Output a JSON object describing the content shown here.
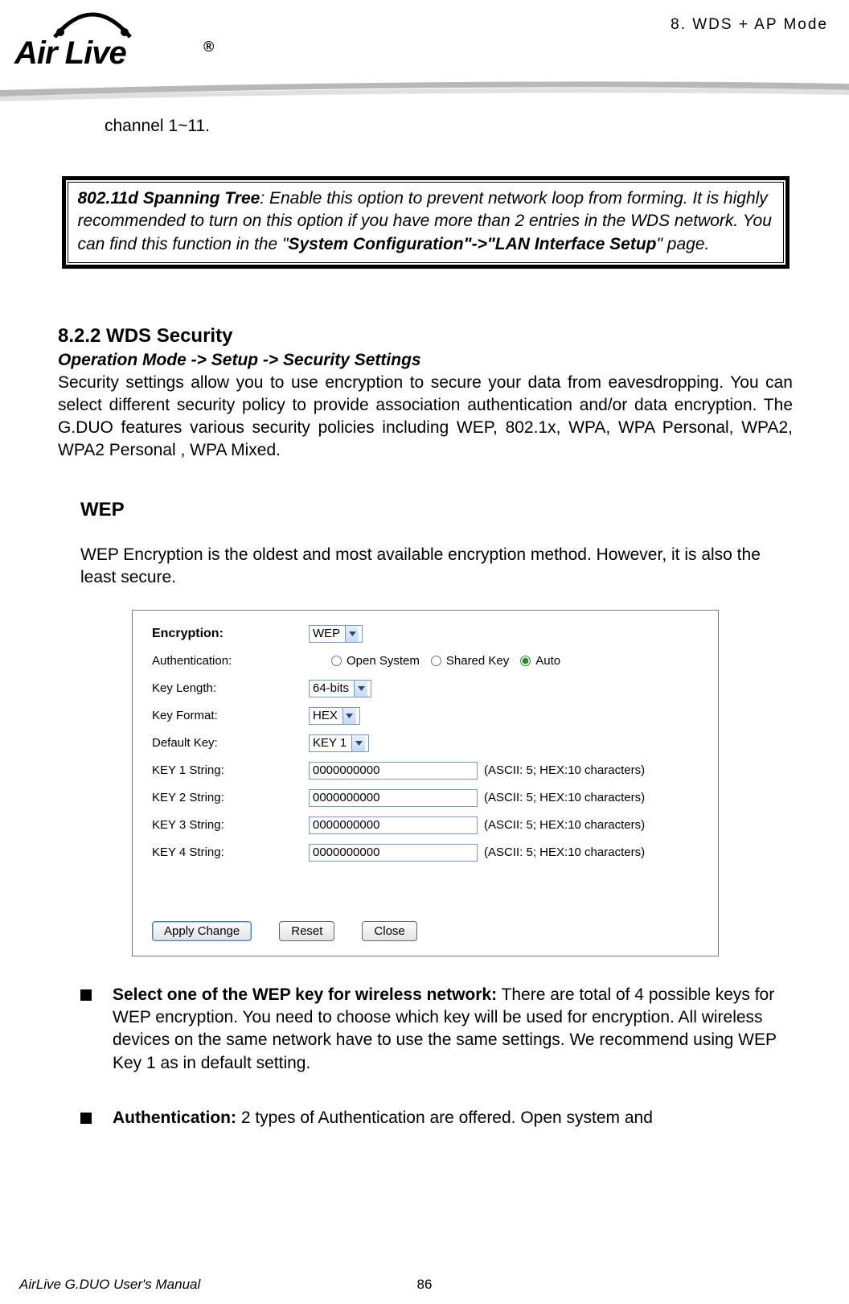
{
  "header": {
    "section_label": "8.  WDS  +  AP  Mode",
    "logo_text": "Air Live"
  },
  "intro_text": "channel 1~11.",
  "note": {
    "prefix": "802.11d Spanning Tree",
    "body1": ":    Enable this option to prevent network loop from forming.  It is highly recommended to turn on this option if you have more than 2 entries in the WDS network.    You can find this function in the \"",
    "bold2": "System Configuration\"->\"LAN Interface Setup",
    "tail": "\" page."
  },
  "section": {
    "heading": "8.2.2 WDS Security",
    "breadcrumb": "Operation Mode -> Setup -> Security Settings",
    "body": "Security settings allow you to use encryption to secure your data from eavesdropping.  You can select different security policy to provide association authentication and/or data encryption.   The G.DUO features various security policies including WEP, 802.1x, WPA, WPA Personal, WPA2, WPA2 Personal , WPA Mixed."
  },
  "wep": {
    "heading": "WEP",
    "body": "WEP Encryption is the oldest and most available encryption method.    However, it is also the least secure."
  },
  "screenshot": {
    "encryption_label": "Encryption:",
    "encryption_value": "WEP",
    "auth_label": "Authentication:",
    "auth_options": [
      "Open System",
      "Shared Key",
      "Auto"
    ],
    "auth_selected": "Auto",
    "keylen_label": "Key Length:",
    "keylen_value": "64-bits",
    "keyformat_label": "Key Format:",
    "keyformat_value": "HEX",
    "defaultkey_label": "Default Key:",
    "defaultkey_value": "KEY 1",
    "keys": [
      {
        "label": "KEY 1 String:",
        "value": "0000000000",
        "hint": "(ASCII: 5; HEX:10 characters)"
      },
      {
        "label": "KEY 2 String:",
        "value": "0000000000",
        "hint": "(ASCII: 5; HEX:10 characters)"
      },
      {
        "label": "KEY 3 String:",
        "value": "0000000000",
        "hint": "(ASCII: 5; HEX:10 characters)"
      },
      {
        "label": "KEY 4 String:",
        "value": "0000000000",
        "hint": "(ASCII: 5; HEX:10 characters)"
      }
    ],
    "btn_apply": "Apply Change",
    "btn_reset": "Reset",
    "btn_close": "Close"
  },
  "bullets": {
    "b1_title": "Select one of the WEP key for wireless network:",
    "b1_body": "    There are total of 4 possible keys for WEP encryption.    You need to choose which key will be used for encryption.    All wireless devices on the same network have to use the same settings.    We recommend using WEP Key 1 as in default setting.",
    "b2_title": "Authentication:",
    "b2_body": "    2 types of Authentication are offered.    Open system and"
  },
  "footer": {
    "left": "AirLive G.DUO User's Manual",
    "page": "86"
  }
}
